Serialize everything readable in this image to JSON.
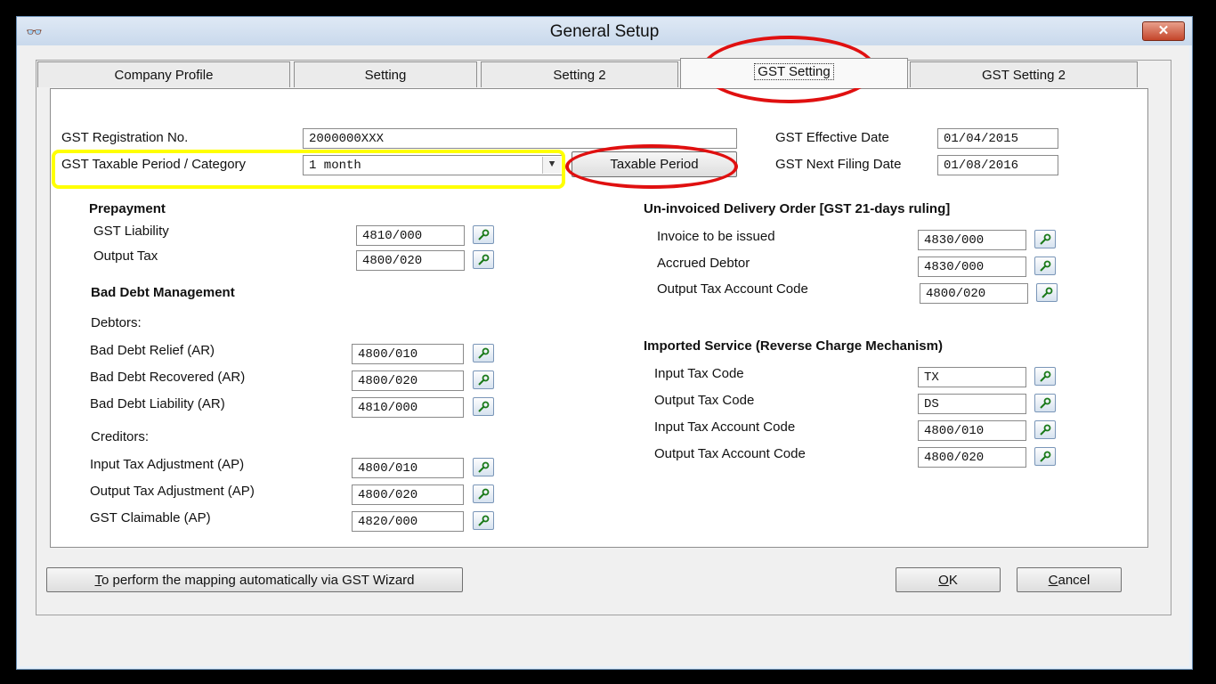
{
  "window": {
    "title": "General Setup",
    "close_label": "✕"
  },
  "tabs": [
    {
      "label": "Company Profile"
    },
    {
      "label": "Setting"
    },
    {
      "label": "Setting 2"
    },
    {
      "label": "GST Setting",
      "active": true
    },
    {
      "label": "GST Setting 2"
    }
  ],
  "top": {
    "reg_label": "GST Registration No.",
    "reg_value": "2000000XXX",
    "period_label": "GST Taxable Period / Category",
    "period_value": "1 month",
    "taxable_period_button": "Taxable Period",
    "effective_label": "GST Effective Date",
    "effective_value": "01/04/2015",
    "next_filing_label": "GST Next Filing Date",
    "next_filing_value": "01/08/2016"
  },
  "prepayment": {
    "header": "Prepayment",
    "items": [
      {
        "label": "GST Liability",
        "value": "4810/000"
      },
      {
        "label": "Output Tax",
        "value": "4800/020"
      }
    ]
  },
  "bad_debt": {
    "header": "Bad Debt Management",
    "debtors_label": "Debtors:",
    "debtors": [
      {
        "label": "Bad Debt Relief (AR)",
        "value": "4800/010"
      },
      {
        "label": "Bad Debt Recovered (AR)",
        "value": "4800/020"
      },
      {
        "label": "Bad Debt Liability (AR)",
        "value": "4810/000"
      }
    ],
    "creditors_label": "Creditors:",
    "creditors": [
      {
        "label": "Input Tax Adjustment (AP)",
        "value": "4800/010"
      },
      {
        "label": "Output Tax Adjustment (AP)",
        "value": "4800/020"
      },
      {
        "label": "GST Claimable (AP)",
        "value": "4820/000"
      }
    ]
  },
  "uninvoiced": {
    "header": "Un-invoiced Delivery Order [GST 21-days ruling]",
    "items": [
      {
        "label": "Invoice to be issued",
        "value": "4830/000"
      },
      {
        "label": "Accrued Debtor",
        "value": "4830/000"
      },
      {
        "label": "Output Tax Account Code",
        "value": "4800/020"
      }
    ]
  },
  "imported": {
    "header": "Imported Service (Reverse Charge Mechanism)",
    "items": [
      {
        "label": "Input Tax Code",
        "value": "TX"
      },
      {
        "label": "Output Tax Code",
        "value": "DS"
      },
      {
        "label": "Input Tax Account Code",
        "value": "4800/010"
      },
      {
        "label": "Output Tax Account Code",
        "value": "4800/020"
      }
    ]
  },
  "footer": {
    "wizard_hotkey": "T",
    "wizard_rest": "o perform the mapping automatically via GST Wizard",
    "ok_hotkey": "O",
    "ok_rest": "K",
    "cancel_hotkey": "C",
    "cancel_rest": "ancel"
  },
  "colors": {
    "highlight_yellow": "#ffff00",
    "highlight_red": "#e01010"
  }
}
